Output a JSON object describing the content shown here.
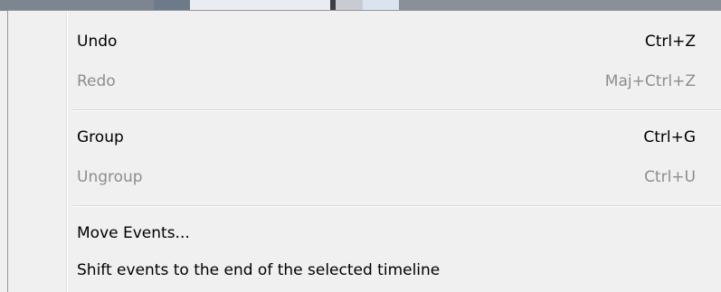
{
  "context_menu": {
    "groups": [
      {
        "items": [
          {
            "label": "Undo",
            "shortcut": "Ctrl+Z",
            "enabled": true
          },
          {
            "label": "Redo",
            "shortcut": "Maj+Ctrl+Z",
            "enabled": false
          }
        ]
      },
      {
        "items": [
          {
            "label": "Group",
            "shortcut": "Ctrl+G",
            "enabled": true
          },
          {
            "label": "Ungroup",
            "shortcut": "Ctrl+U",
            "enabled": false
          }
        ]
      },
      {
        "items": [
          {
            "label": "Move Events...",
            "shortcut": "",
            "enabled": true
          },
          {
            "label": "Shift events to the end of the selected timeline",
            "shortcut": "",
            "enabled": true
          }
        ]
      }
    ]
  },
  "colors": {
    "menu_background": "#f0f0f0",
    "enabled_text": "#000000",
    "disabled_text": "#8d8d8d",
    "separator": "#d7d7d7"
  }
}
